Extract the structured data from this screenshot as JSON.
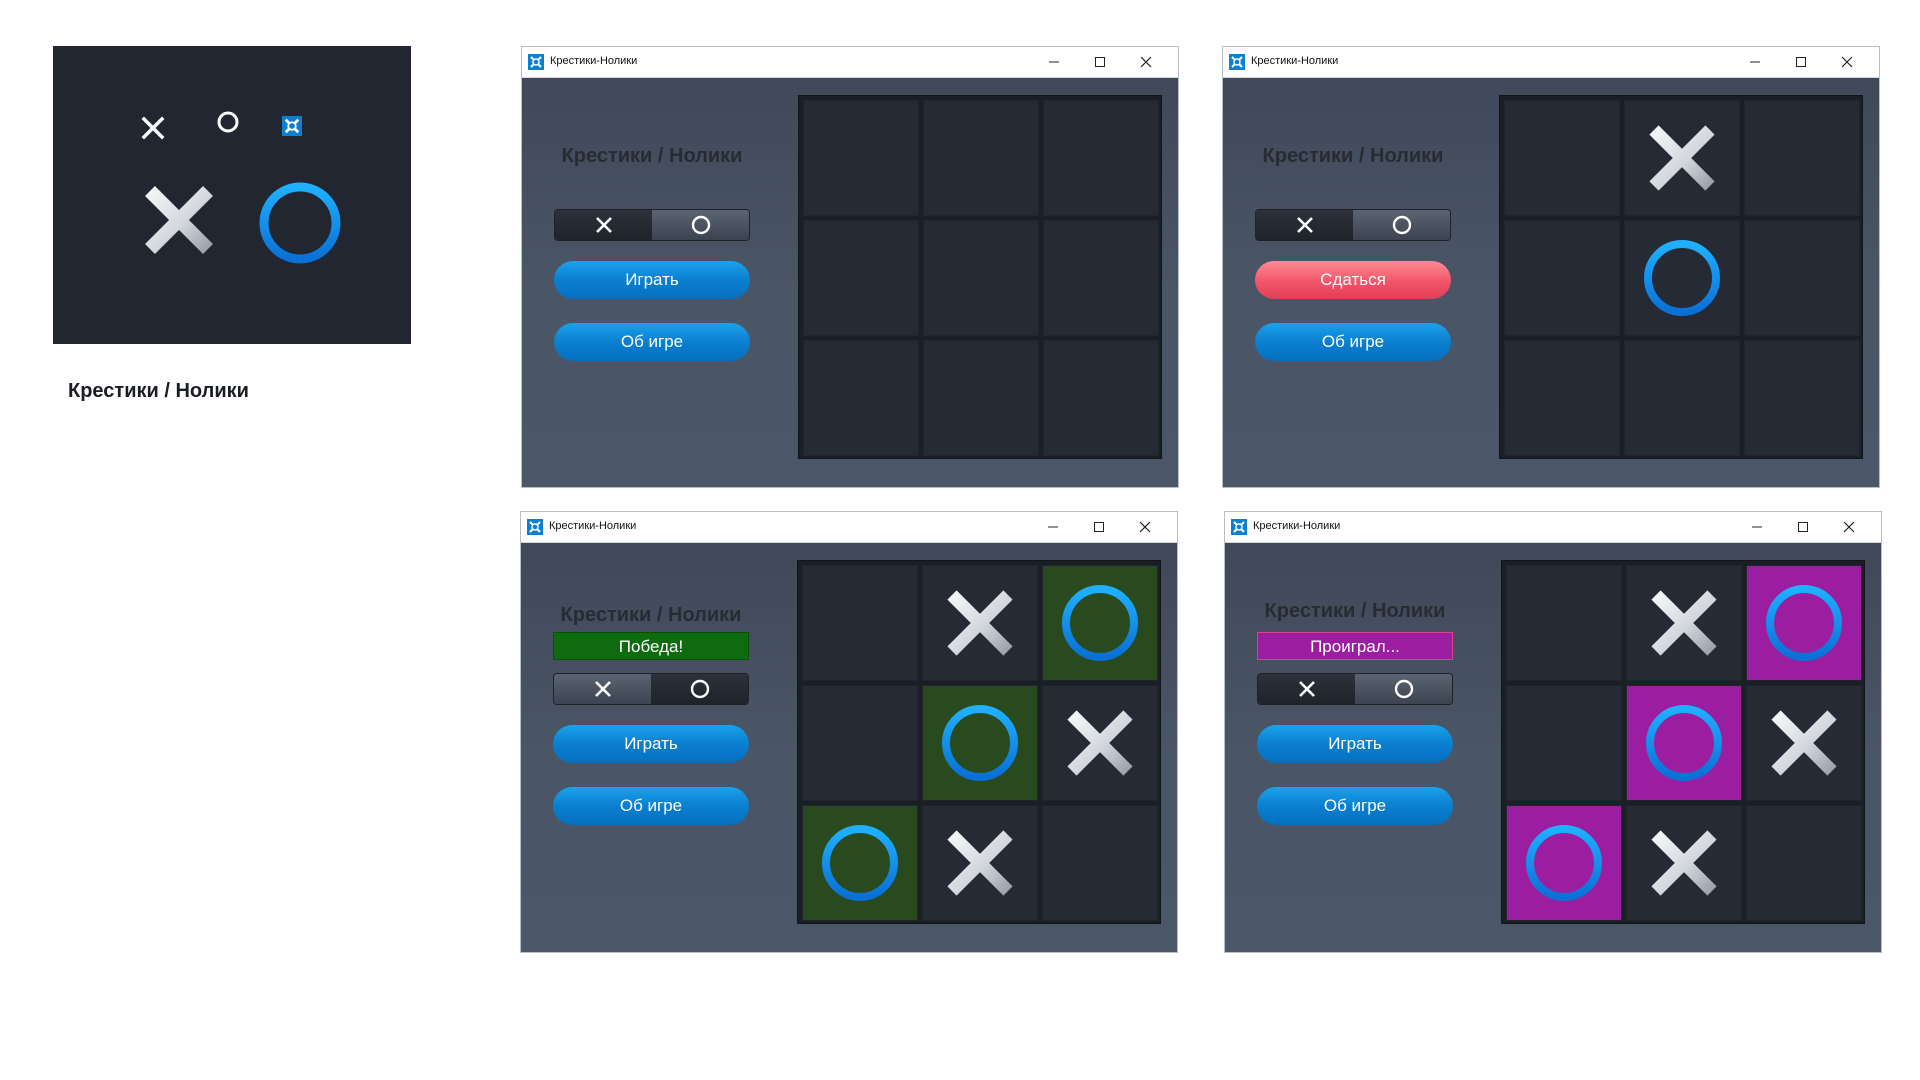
{
  "preview": {
    "caption": "Крестики / Нолики"
  },
  "colors": {
    "accent_blue": "#0b7fd0",
    "surrender_red": "#f2546a",
    "win_green": "#0f6b0f",
    "lose_purple": "#9b1ea0",
    "win_cell": "#284a1e",
    "lose_cell": "#9b1ea0"
  },
  "icons": {
    "app": "tic-tac-toe-icon",
    "minimize": "minimize-icon",
    "maximize": "maximize-icon",
    "close": "close-icon",
    "cross": "cross-icon",
    "circle": "circle-icon"
  },
  "windows": [
    {
      "title": "Крестики-Нолики",
      "heading": "Крестики / Нолики",
      "status": "",
      "toggle": [
        "X",
        "O"
      ],
      "primary_button": "Играть",
      "about_button": "Об игре",
      "board": [
        "",
        "",
        "",
        "",
        "",
        "",
        "",
        "",
        ""
      ]
    },
    {
      "title": "Крестики-Нолики",
      "heading": "Крестики / Нолики",
      "status": "",
      "toggle": [
        "X",
        "O"
      ],
      "primary_button": "Сдаться",
      "about_button": "Об игре",
      "board": [
        "",
        "X",
        "",
        "",
        "O",
        "",
        "",
        "",
        ""
      ]
    },
    {
      "title": "Крестики-Нолики",
      "heading": "Крестики / Нолики",
      "status": "Победа!",
      "toggle": [
        "X",
        "O"
      ],
      "primary_button": "Играть",
      "about_button": "Об игре",
      "board": [
        "",
        "X",
        "O",
        "",
        "O",
        "X",
        "O",
        "X",
        ""
      ],
      "highlight": [
        2,
        4,
        6
      ]
    },
    {
      "title": "Крестики-Нолики",
      "heading": "Крестики / Нолики",
      "status": "Проиграл...",
      "toggle": [
        "X",
        "O"
      ],
      "primary_button": "Играть",
      "about_button": "Об игре",
      "board": [
        "",
        "X",
        "O",
        "",
        "O",
        "X",
        "O",
        "X",
        ""
      ],
      "highlight": [
        2,
        4,
        6
      ]
    }
  ]
}
